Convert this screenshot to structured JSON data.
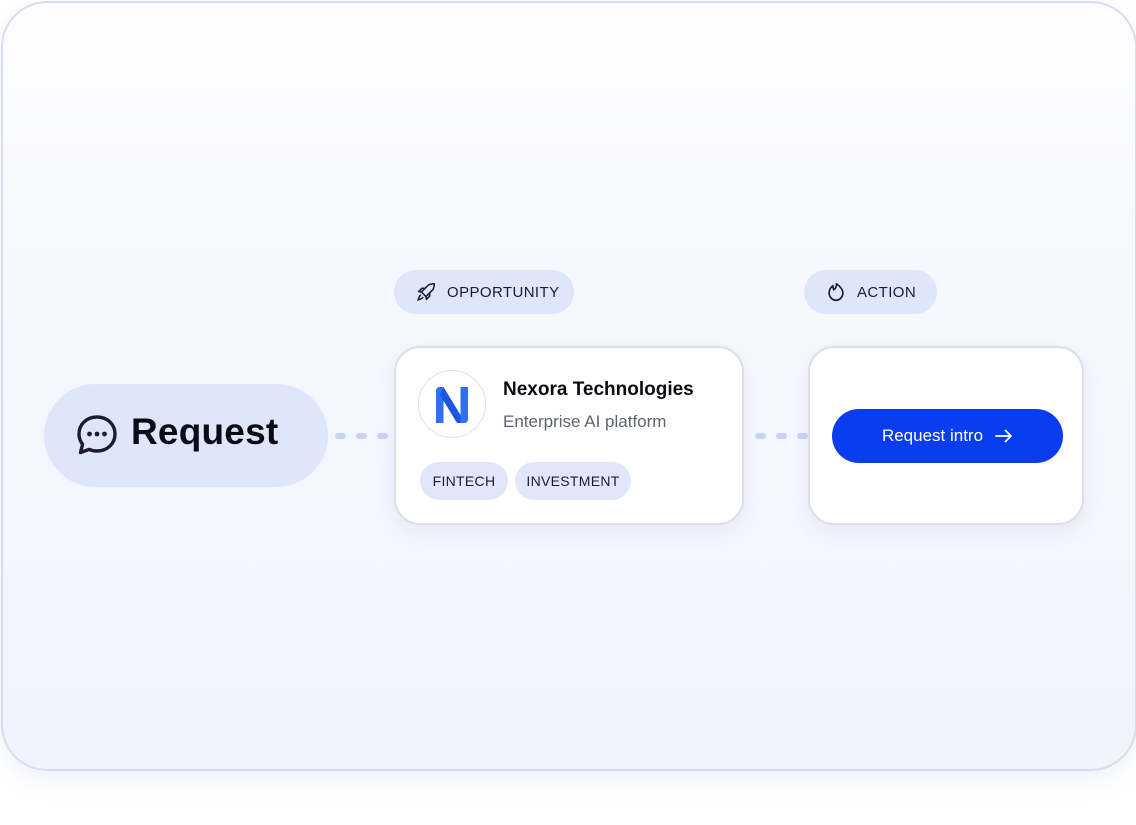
{
  "request": {
    "label": "Request",
    "icon": "chat-bubble-icon"
  },
  "opportunity": {
    "badge_label": "OPPORTUNITY",
    "badge_icon": "rocket-icon",
    "company_name": "Nexora Technologies",
    "company_desc": "Enterprise AI platform",
    "logo_letter": "N",
    "tags": [
      "FINTECH",
      "INVESTMENT"
    ]
  },
  "action": {
    "badge_label": "ACTION",
    "badge_icon": "flame-icon",
    "button_label": "Request intro",
    "button_icon": "arrow-right-icon"
  },
  "colors": {
    "accent": "#0a3df0",
    "pill_bg": "#dfe5fb",
    "logo_blue": "#2f6ff0"
  }
}
